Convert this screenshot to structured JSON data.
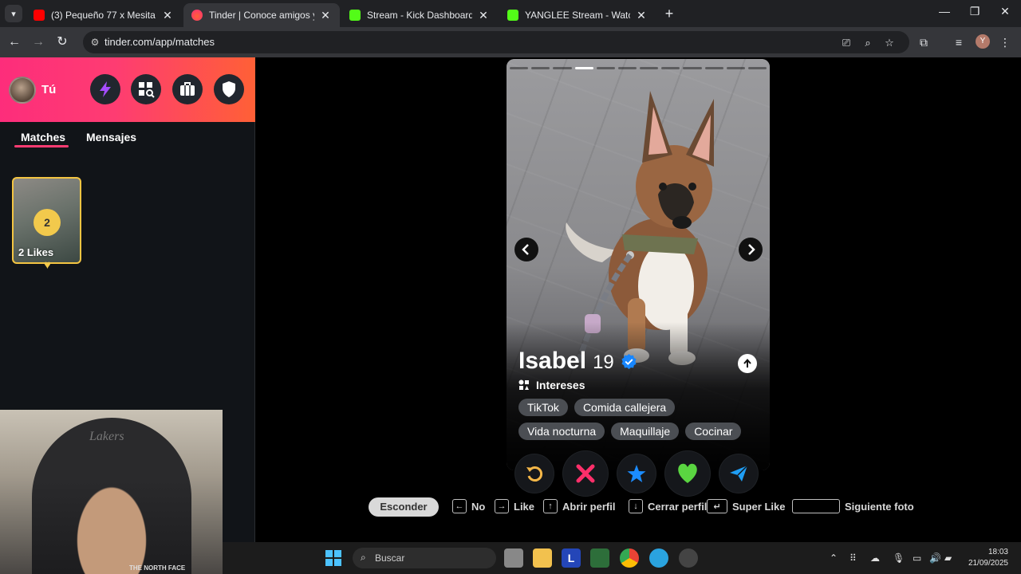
{
  "browser": {
    "tabs": [
      {
        "title": "(3) Pequeño 77 x Mesita x T-White",
        "favicon": "youtube-icon",
        "active": false
      },
      {
        "title": "Tinder | Conoce amigos y gente",
        "favicon": "tinder-icon",
        "active": true
      },
      {
        "title": "Stream - Kick Dashboard",
        "favicon": "kick-icon",
        "active": false
      },
      {
        "title": "YANGLEE Stream - Watch Live on Kick",
        "favicon": "kick-icon",
        "active": false
      }
    ],
    "url": "tinder.com/app/matches",
    "profile_initial": "Y"
  },
  "sidebar": {
    "me_label": "Tú",
    "tabs": [
      {
        "label": "Matches",
        "active": true
      },
      {
        "label": "Mensajes",
        "active": false
      }
    ],
    "likes_card": {
      "count": "2",
      "label": "2 Likes"
    },
    "brand_gradient": [
      "#fd2d7b",
      "#ff6036"
    ]
  },
  "profile": {
    "name": "Isabel",
    "age": "19",
    "verified": true,
    "photo_index": 3,
    "photo_count": 12,
    "interests_label": "Intereses",
    "interests": [
      "TikTok",
      "Comida callejera",
      "Vida nocturna",
      "Maquillaje",
      "Cocinar"
    ]
  },
  "actions": [
    {
      "name": "rewind",
      "color": "#f5b748"
    },
    {
      "name": "nope",
      "color": "#fe2f6a"
    },
    {
      "name": "super-like",
      "color": "#1b8cff"
    },
    {
      "name": "like",
      "color": "#2ad58a"
    },
    {
      "name": "boost",
      "color": "#1f9ef5"
    }
  ],
  "hints": {
    "hide": "Esconder",
    "no": "No",
    "like": "Like",
    "open": "Abrir perfil",
    "close": "Cerrar perfil",
    "superlike": "Super Like",
    "next": "Siguiente foto"
  },
  "webcam": {
    "cap_text": "Lakers",
    "shirt_text": "THE NORTH FACE"
  },
  "taskbar": {
    "search_placeholder": "Buscar",
    "time": "18:03",
    "date": "21/09/2025"
  }
}
